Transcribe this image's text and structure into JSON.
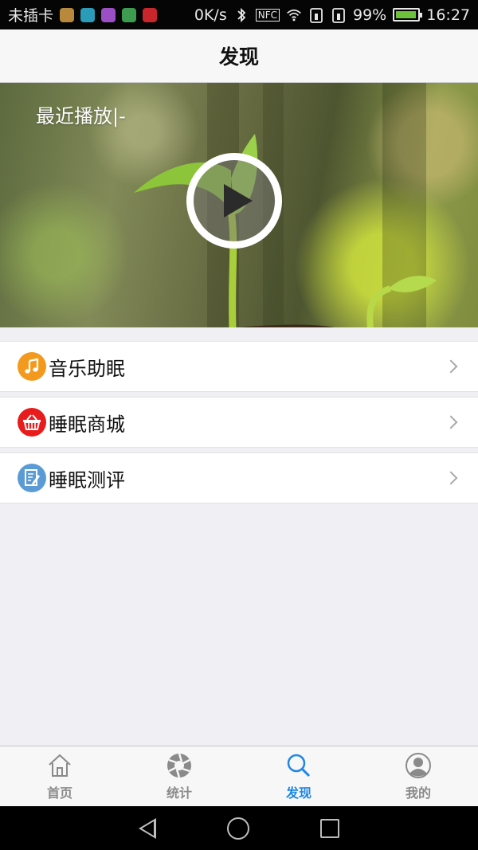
{
  "status_bar": {
    "carrier": "未插卡",
    "speed": "0K/s",
    "nfc": "NFC",
    "battery": "99%",
    "time": "16:27",
    "app_icon_colors": [
      "#b8893c",
      "#2a9bb8",
      "#9b4fc4",
      "#3d9c4f",
      "#c8262c"
    ]
  },
  "header": {
    "title": "发现"
  },
  "banner": {
    "label": "最近播放|-"
  },
  "menu": [
    {
      "label": "音乐助眠",
      "icon": "music-note-icon",
      "color": "#f39a1e",
      "glyph": "♫"
    },
    {
      "label": "睡眠商城",
      "icon": "shopping-basket-icon",
      "color": "#e81c1c",
      "glyph": ""
    },
    {
      "label": "睡眠测评",
      "icon": "assessment-icon",
      "color": "#5b9bd5",
      "glyph": ""
    }
  ],
  "tabs": [
    {
      "label": "首页",
      "icon": "home-icon",
      "active": false
    },
    {
      "label": "统计",
      "icon": "aperture-icon",
      "active": false
    },
    {
      "label": "发现",
      "icon": "search-icon",
      "active": true
    },
    {
      "label": "我的",
      "icon": "user-icon",
      "active": false
    }
  ],
  "colors": {
    "accent": "#1e88e5",
    "inactive": "#8a8a8a"
  }
}
